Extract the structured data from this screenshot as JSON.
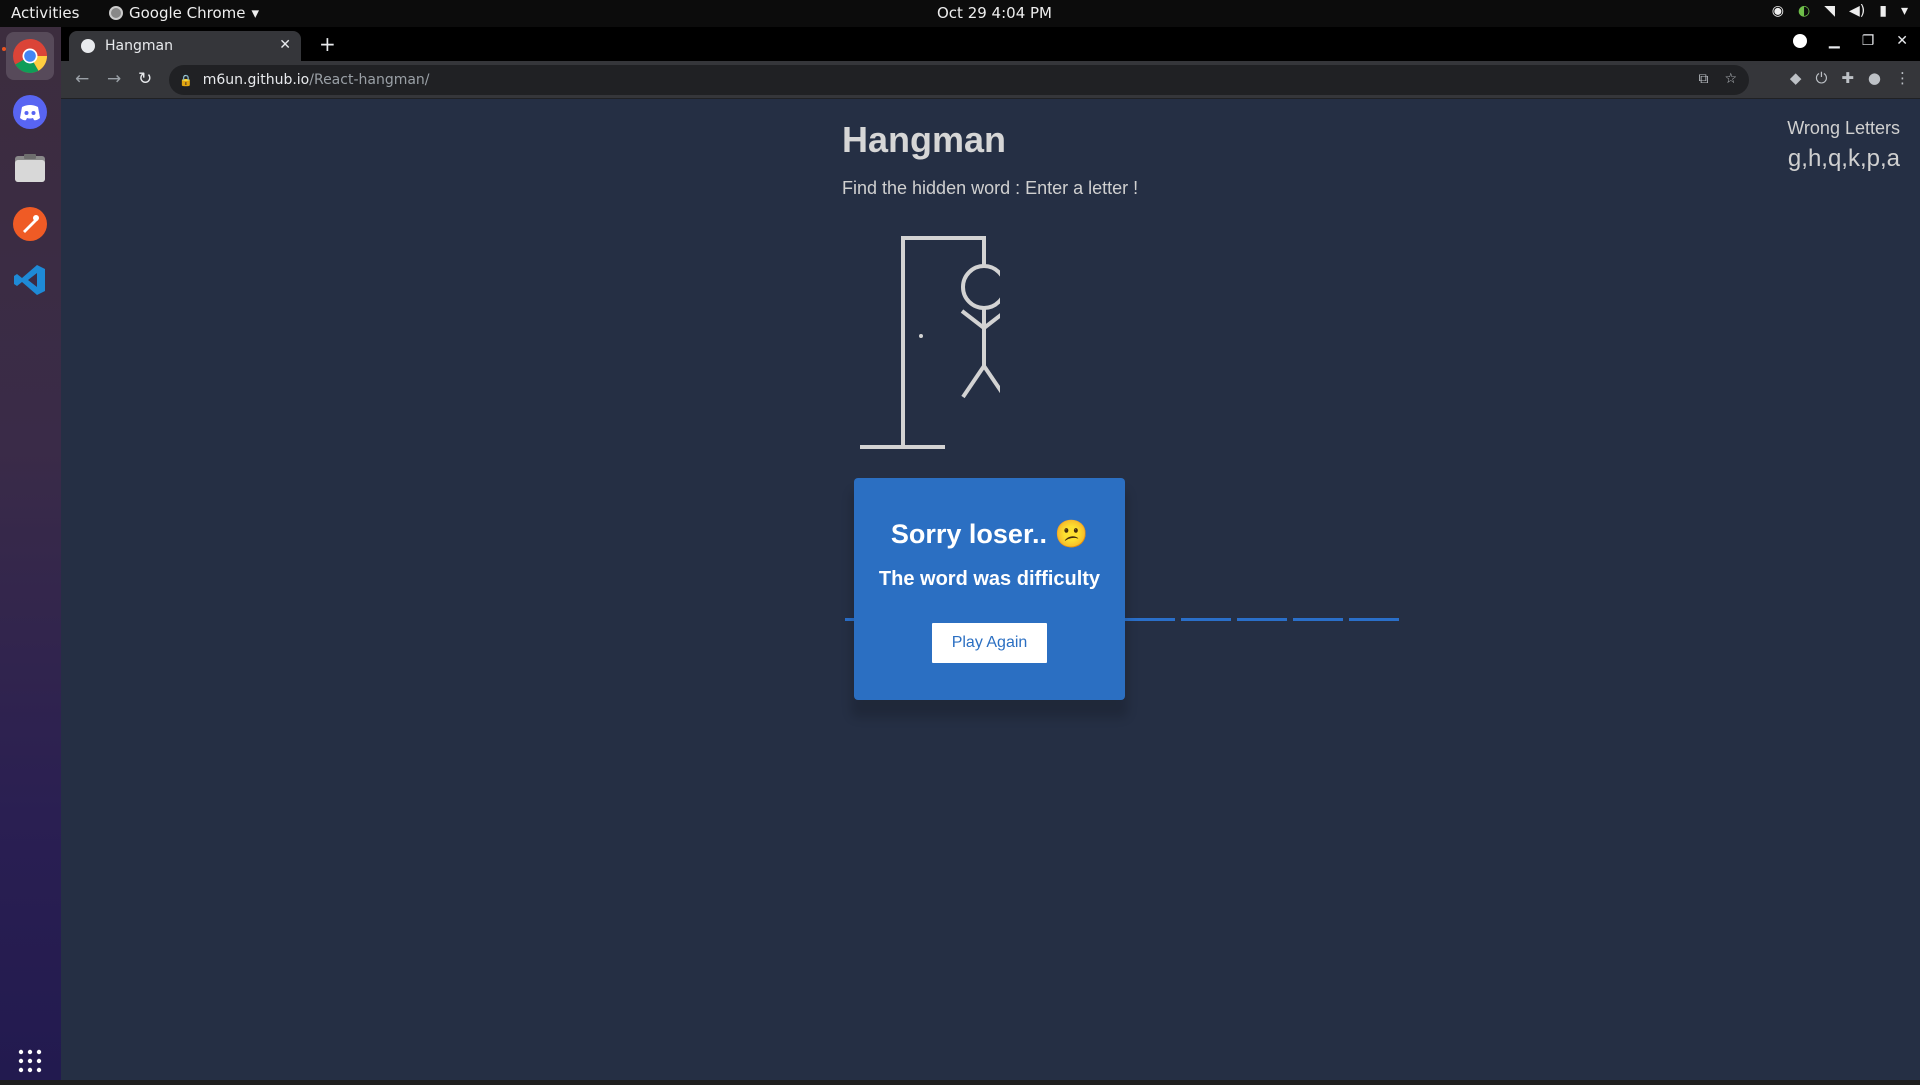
{
  "topbar": {
    "activities": "Activities",
    "app_name": "Google Chrome",
    "clock": "Oct 29   4:04 PM"
  },
  "dock": {
    "items": [
      {
        "name": "chrome-icon",
        "active": true
      },
      {
        "name": "discord-icon"
      },
      {
        "name": "files-icon"
      },
      {
        "name": "postman-icon"
      },
      {
        "name": "vscode-icon"
      }
    ],
    "apps_grid_icon": "apps-grid-icon"
  },
  "browser": {
    "tab_title": "Hangman",
    "url_domain": "m6un.github.io",
    "url_path": "/React-hangman/"
  },
  "game": {
    "title": "Hangman",
    "subtitle": "Find the hidden word : Enter a letter !",
    "wrong_label": "Wrong Letters",
    "wrong_letters": "g,h,q,k,p,a",
    "blank_count": 10,
    "popup": {
      "title": "Sorry loser.. 😕",
      "message": "The word was difficulty",
      "button_label": "Play Again"
    }
  },
  "colors": {
    "page_bg": "#252f44",
    "popup_bg": "#2b6fc2",
    "figure_stroke": "#d3d3d3",
    "blank_line": "#2a6fc9"
  }
}
